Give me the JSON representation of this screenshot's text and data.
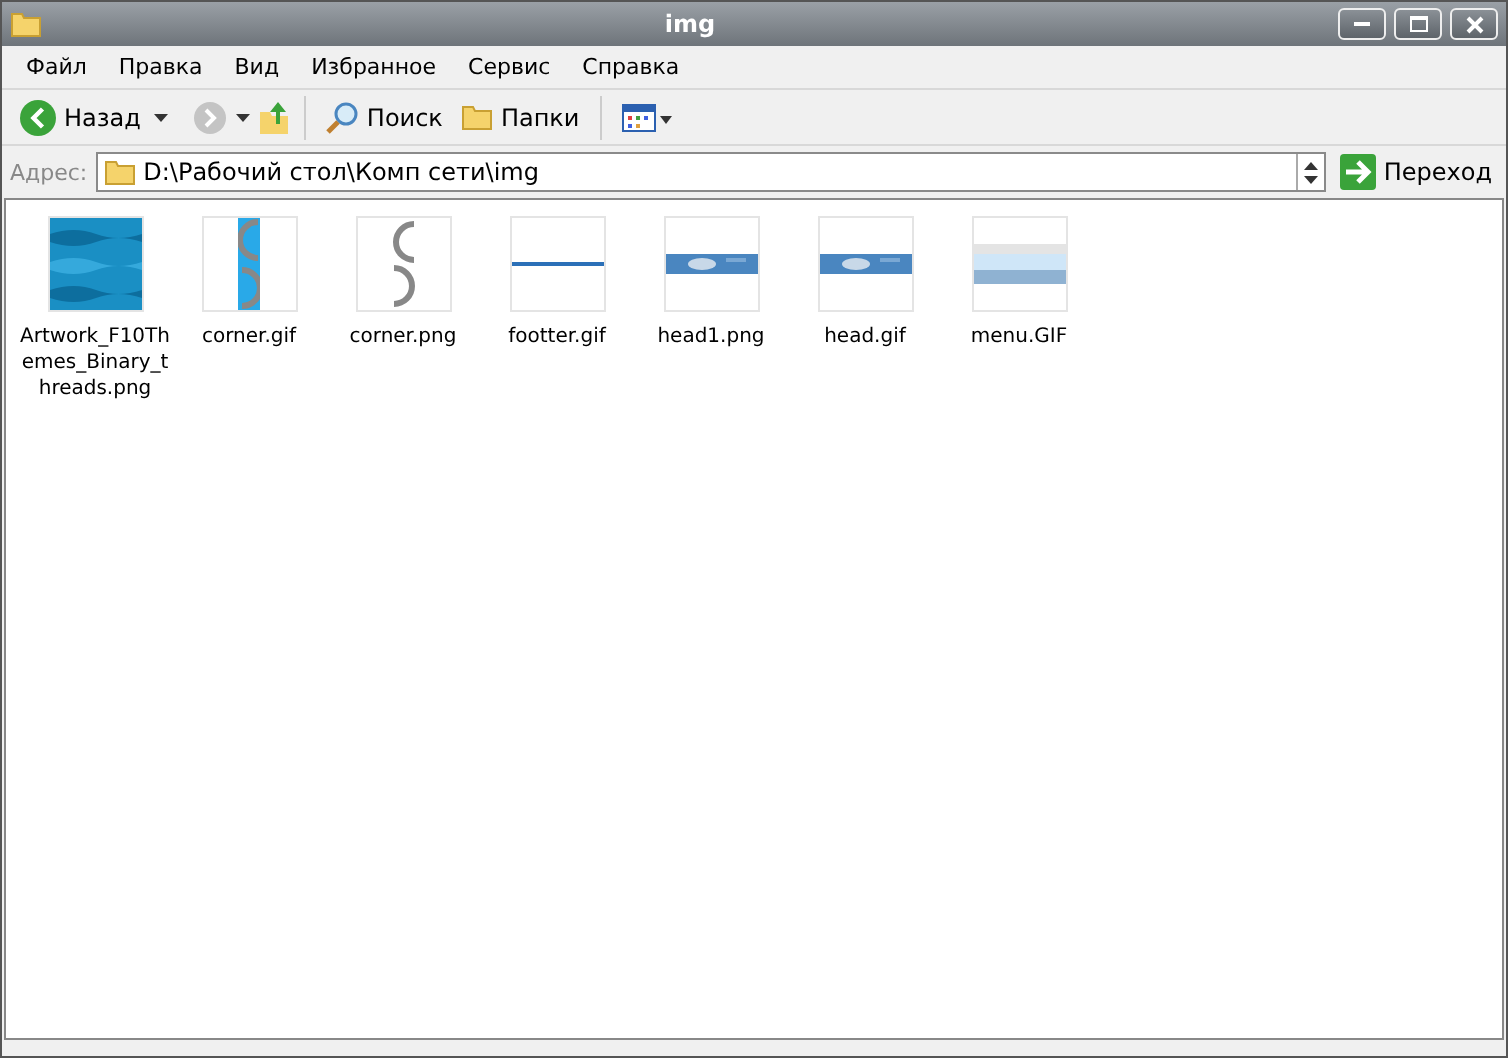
{
  "window": {
    "title": "img"
  },
  "menu": [
    "Файл",
    "Правка",
    "Вид",
    "Избранное",
    "Сервис",
    "Справка"
  ],
  "toolbar": {
    "back": "Назад",
    "search": "Поиск",
    "folders": "Папки"
  },
  "address": {
    "label": "Адрес:",
    "value": "D:\\Рабочий стол\\Комп сети\\img",
    "go": "Переход"
  },
  "files": [
    {
      "name": "Artwork_F10Themes_Binary_threads.png"
    },
    {
      "name": "corner.gif"
    },
    {
      "name": "corner.png"
    },
    {
      "name": "footter.gif"
    },
    {
      "name": "head1.png"
    },
    {
      "name": "head.gif"
    },
    {
      "name": "menu.GIF"
    }
  ]
}
